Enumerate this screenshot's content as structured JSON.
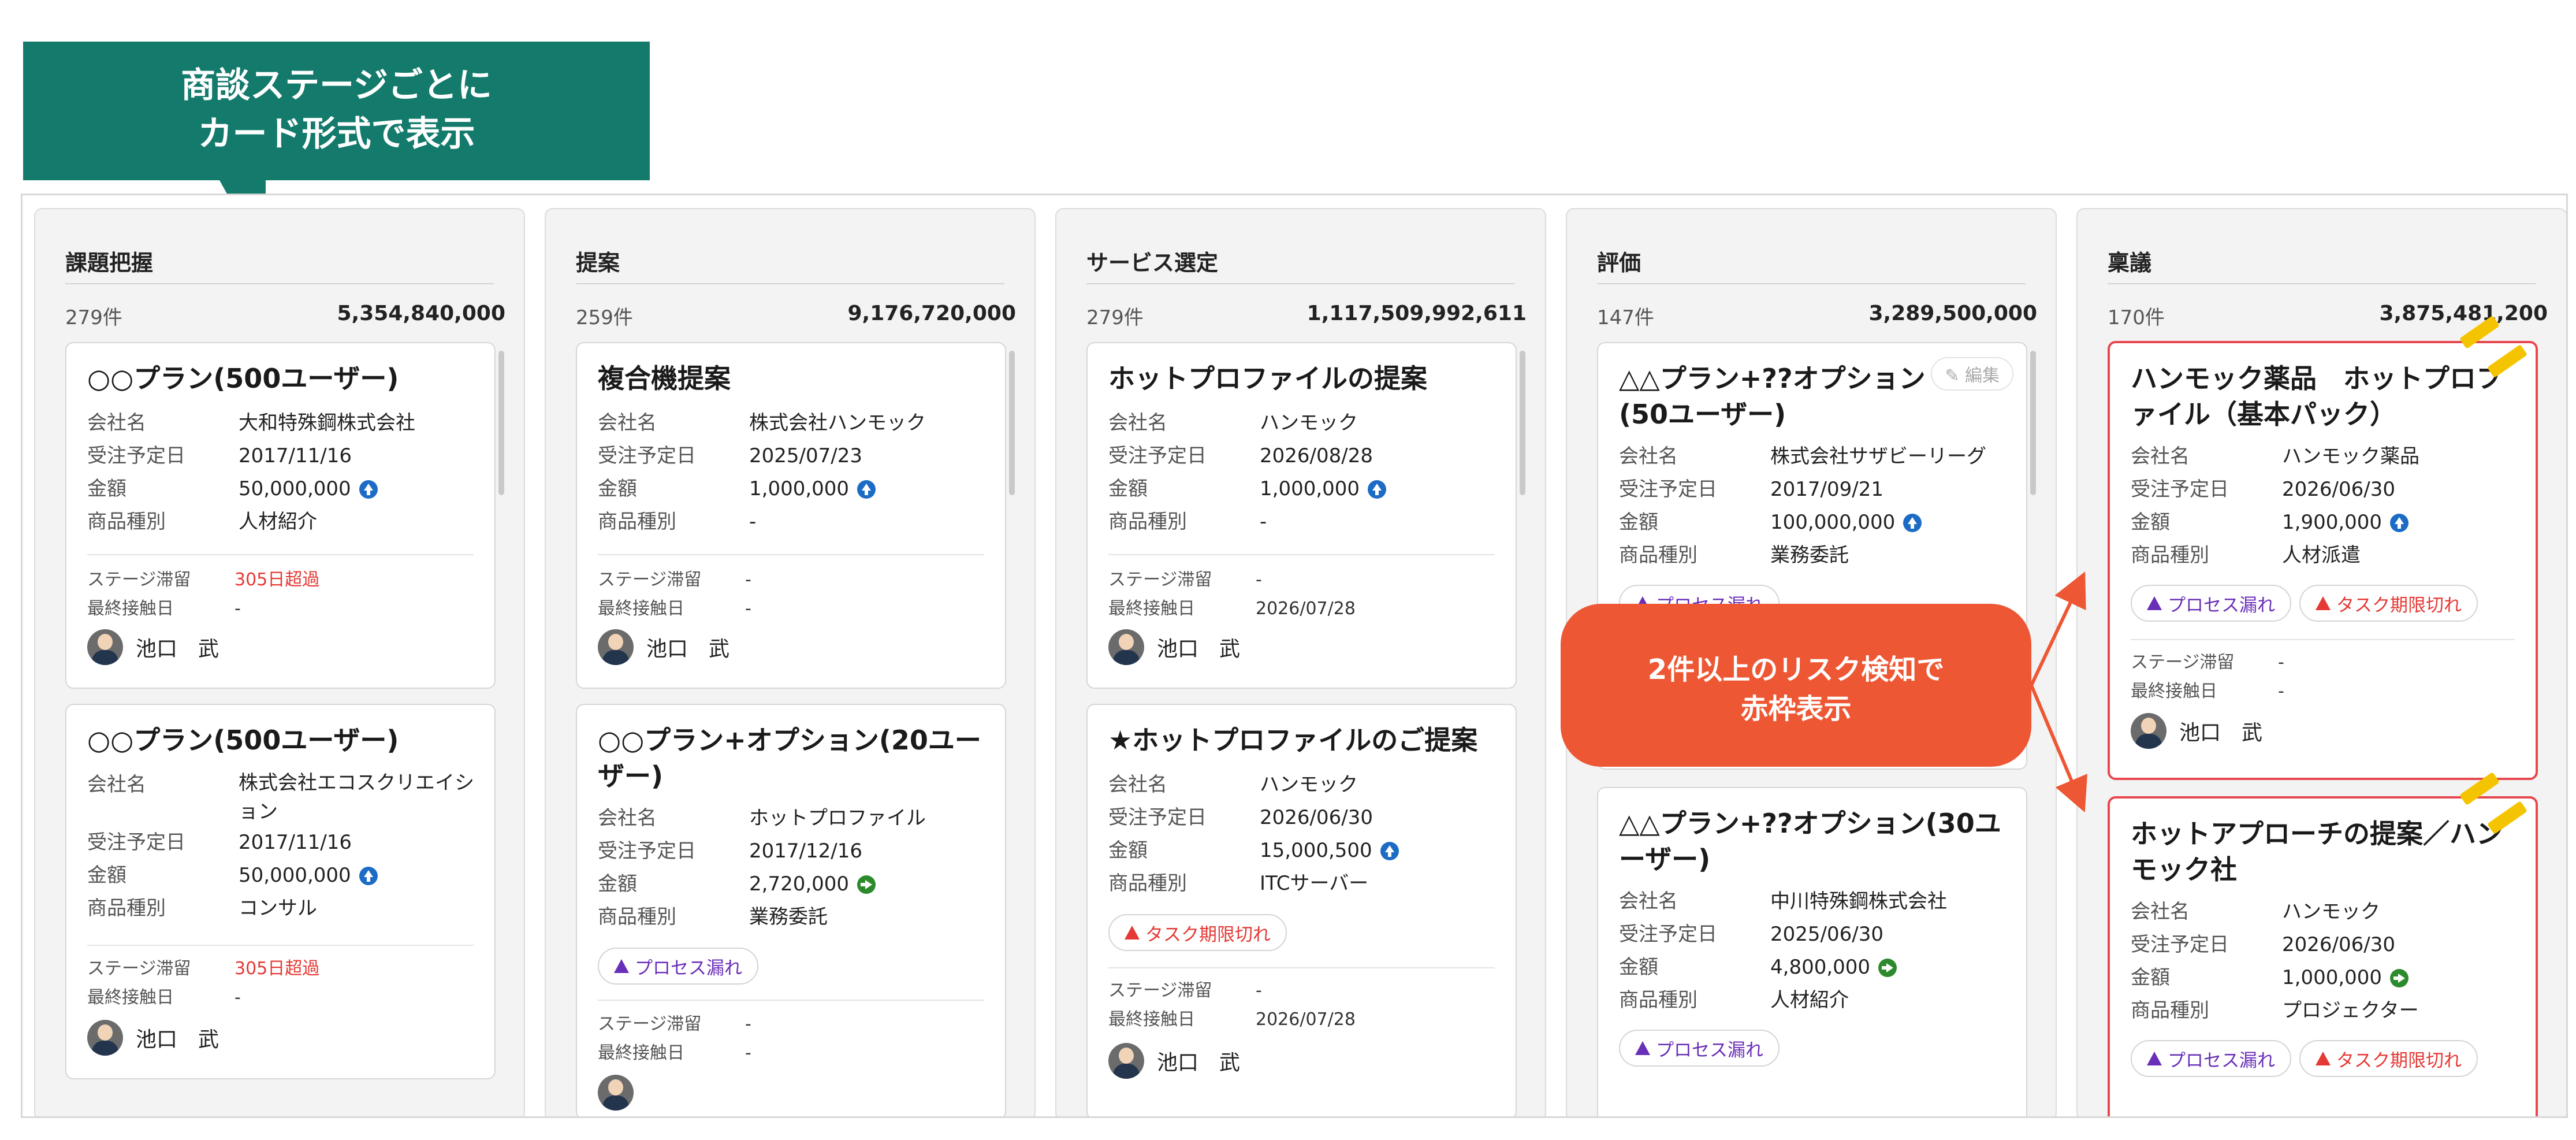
{
  "callout_top": {
    "line1": "商談ステージごとに",
    "line2": "カード形式で表示"
  },
  "risk_callout": {
    "line1": "2件以上のリスク検知で",
    "line2": "赤枠表示"
  },
  "labels": {
    "company": "会社名",
    "order_date": "受注予定日",
    "amount": "金額",
    "product_type": "商品種別",
    "stage_stay": "ステージ滞留",
    "last_contact": "最終接触日",
    "owner": "池口　武",
    "edit": "✎ 編集",
    "tag_process": "プロセス漏れ",
    "tag_task": "タスク期限切れ"
  },
  "columns": [
    {
      "title": "課題把握",
      "count": "279件",
      "amount": "5,354,840,000",
      "cards": [
        {
          "title": "○○プラン(500ユーザー)",
          "company": "大和特殊鋼株式会社",
          "order_date": "2017/11/16",
          "amount": "50,000,000",
          "product_type": "人材紹介",
          "stage_stay": "305日超過",
          "last_contact": "-"
        },
        {
          "title": "○○プラン(500ユーザー)",
          "company": "株式会社エコスクリエイション",
          "order_date": "2017/11/16",
          "amount": "50,000,000",
          "product_type": "コンサル",
          "stage_stay": "305日超過",
          "last_contact": "-"
        }
      ]
    },
    {
      "title": "提案",
      "count": "259件",
      "amount": "9,176,720,000",
      "cards": [
        {
          "title": "複合機提案",
          "company": "株式会社ハンモック",
          "order_date": "2025/07/23",
          "amount": "1,000,000",
          "product_type": "-",
          "stage_stay": "-",
          "last_contact": "-"
        },
        {
          "title": "○○プラン+オプション(20ユーザー)",
          "company": "ホットプロファイル",
          "order_date": "2017/12/16",
          "amount": "2,720,000",
          "product_type": "業務委託",
          "stage_stay": "-",
          "last_contact": "-"
        }
      ]
    },
    {
      "title": "サービス選定",
      "count": "279件",
      "amount": "1,117,509,992,611",
      "cards": [
        {
          "title": "ホットプロファイルの提案",
          "company": "ハンモック",
          "order_date": "2026/08/28",
          "amount": "1,000,000",
          "product_type": "-",
          "stage_stay": "-",
          "last_contact": "2026/07/28"
        },
        {
          "title": "★ホットプロファイルのご提案",
          "company": "ハンモック",
          "order_date": "2026/06/30",
          "amount": "15,000,500",
          "product_type": "ITCサーバー",
          "stage_stay": "-",
          "last_contact": "2026/07/28"
        }
      ]
    },
    {
      "title": "評価",
      "count": "147件",
      "amount": "3,289,500,000",
      "cards": [
        {
          "title": "△△プラン+??オプション(50ユーザー)",
          "company": "株式会社サザビーリーグ",
          "order_date": "2017/09/21",
          "amount": "100,000,000",
          "product_type": "業務委託"
        },
        {
          "title": "△△プラン+??オプション(30ユーザー)",
          "company": "中川特殊鋼株式会社",
          "order_date": "2025/06/30",
          "amount": "4,800,000",
          "product_type": "人材紹介"
        }
      ]
    },
    {
      "title": "稟議",
      "count": "170件",
      "amount": "3,875,481,200",
      "cards": [
        {
          "title": "ハンモック薬品　ホットプロファイル（基本パック）",
          "company": "ハンモック薬品",
          "order_date": "2026/06/30",
          "amount": "1,900,000",
          "product_type": "人材派遣",
          "stage_stay": "-",
          "last_contact": "-"
        },
        {
          "title": "ホットアプローチの提案／ハンモック社",
          "company": "ハンモック",
          "order_date": "2026/06/30",
          "amount": "1,000,000",
          "product_type": "プロジェクター"
        }
      ]
    }
  ],
  "colors": {
    "callout_green": "#137a6c",
    "risk_orange": "#ee5733",
    "risk_border": "#e8474f",
    "up_icon": "#1c6cc5",
    "right_icon": "#2c8a2c"
  }
}
